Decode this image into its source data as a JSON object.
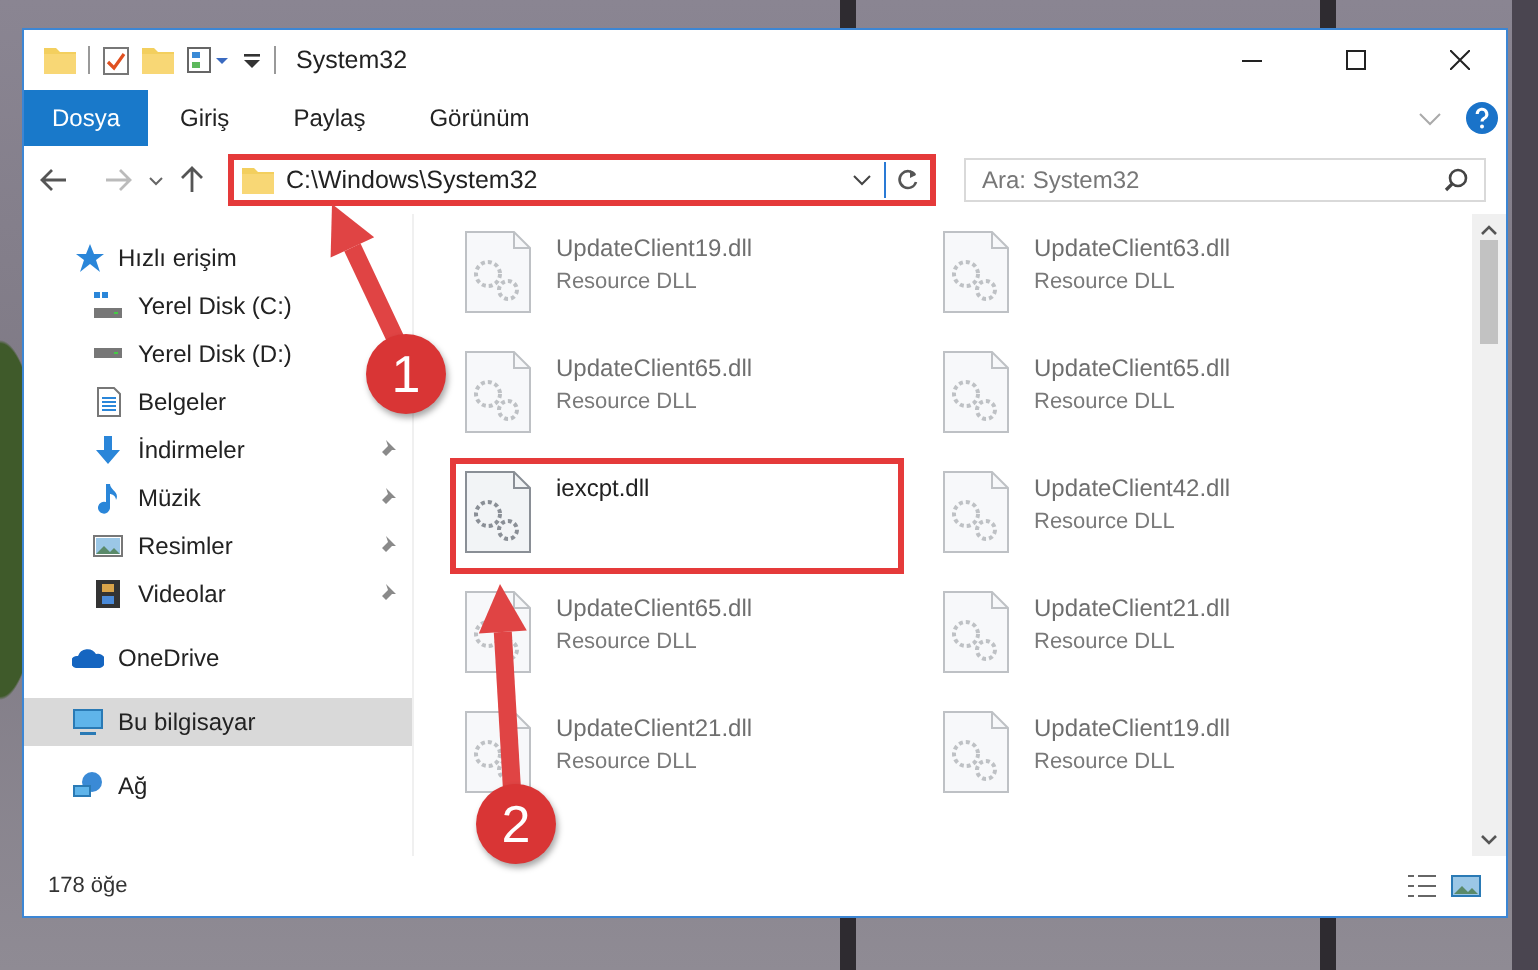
{
  "window": {
    "title": "System32"
  },
  "ribbon_tabs": [
    {
      "label": "Dosya",
      "selected": true
    },
    {
      "label": "Giriş",
      "selected": false
    },
    {
      "label": "Paylaş",
      "selected": false
    },
    {
      "label": "Görünüm",
      "selected": false
    }
  ],
  "address_bar": {
    "path": "C:\\Windows\\System32",
    "highlighted": true
  },
  "search": {
    "placeholder": "Ara: System32"
  },
  "sidebar": {
    "items": [
      {
        "label": "Hızlı erişim",
        "kind": "star",
        "pinned": false,
        "selected": false,
        "group_start": false
      },
      {
        "label": "Yerel Disk (C:)",
        "kind": "disk-c",
        "pinned": false,
        "selected": false,
        "group_start": false
      },
      {
        "label": "Yerel Disk (D:)",
        "kind": "disk",
        "selected": false,
        "group_start": false
      },
      {
        "label": "Belgeler",
        "kind": "document",
        "selected": false,
        "group_start": false
      },
      {
        "label": "İndirmeler",
        "kind": "download",
        "pinned": true,
        "selected": false,
        "group_start": false
      },
      {
        "label": "Müzik",
        "kind": "music",
        "pinned": true,
        "selected": false,
        "group_start": false
      },
      {
        "label": "Resimler",
        "kind": "image",
        "pinned": true,
        "selected": false,
        "group_start": false
      },
      {
        "label": "Videolar",
        "kind": "video",
        "pinned": true,
        "selected": false,
        "group_start": false
      },
      {
        "label": "OneDrive",
        "kind": "cloud",
        "pinned": false,
        "selected": false,
        "group_start": true
      },
      {
        "label": "Bu bilgisayar",
        "kind": "computer",
        "pinned": false,
        "selected": true,
        "group_start": true
      },
      {
        "label": "Ağ",
        "kind": "network",
        "pinned": false,
        "selected": false,
        "group_start": true
      }
    ]
  },
  "files": [
    {
      "name": "UpdateClient19.dll",
      "type": "Resource DLL",
      "dimmed": true,
      "highlighted": false
    },
    {
      "name": "UpdateClient63.dll",
      "type": "Resource DLL",
      "dimmed": true,
      "highlighted": false
    },
    {
      "name": "UpdateClient65.dll",
      "type": "Resource DLL",
      "dimmed": true,
      "highlighted": false
    },
    {
      "name": "UpdateClient65.dll",
      "type": "Resource DLL",
      "dimmed": true,
      "highlighted": false
    },
    {
      "name": "iexcpt.dll",
      "dimmed": false,
      "highlighted": true
    },
    {
      "name": "UpdateClient42.dll",
      "type": "Resource DLL",
      "dimmed": true,
      "highlighted": false
    },
    {
      "name": "UpdateClient65.dll",
      "type": "Resource DLL",
      "dimmed": true,
      "highlighted": false
    },
    {
      "name": "UpdateClient21.dll",
      "type": "Resource DLL",
      "dimmed": true,
      "highlighted": false
    },
    {
      "name": "UpdateClient21.dll",
      "type": "Resource DLL",
      "dimmed": true,
      "highlighted": false
    },
    {
      "name": "UpdateClient19.dll",
      "type": "Resource DLL",
      "dimmed": true,
      "highlighted": false
    }
  ],
  "status_bar": {
    "item_count": "178 öğe"
  },
  "annotations": [
    {
      "label": "1"
    },
    {
      "label": "2"
    }
  ]
}
